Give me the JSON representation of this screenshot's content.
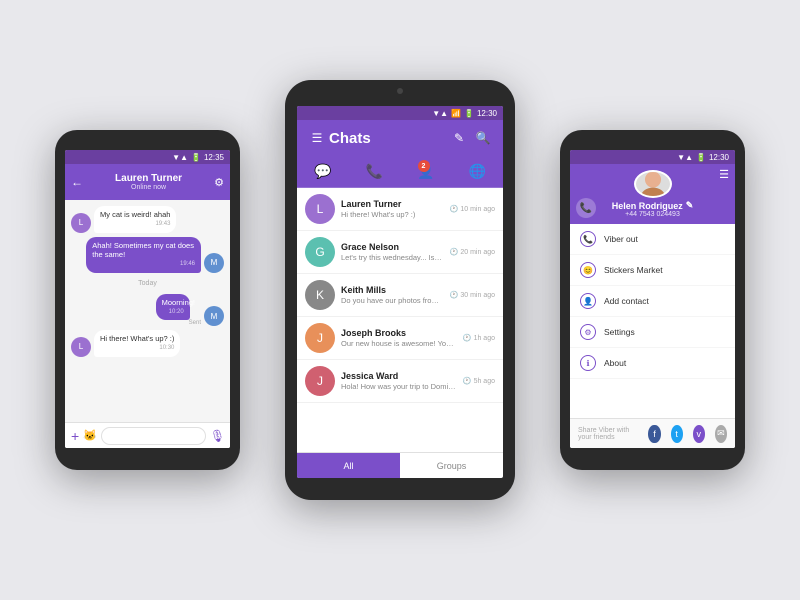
{
  "colors": {
    "purple": "#7b4fc9",
    "purple_dark": "#5a2d90",
    "purple_light": "#9b70d0",
    "bg": "#e8e8ec",
    "phone_shell": "#2a2a2a"
  },
  "center_phone": {
    "status_bar": {
      "time": "12:30"
    },
    "header": {
      "menu_label": "☰",
      "title": "Chats",
      "edit_label": "✎",
      "search_label": "🔍"
    },
    "tabs": [
      {
        "icon": "💬",
        "active": true,
        "label": "Messages"
      },
      {
        "icon": "📞",
        "active": false,
        "label": "Calls"
      },
      {
        "icon": "👤",
        "active": false,
        "label": "Contacts",
        "badge": "2"
      },
      {
        "icon": "🌐",
        "active": false,
        "label": "More"
      }
    ],
    "chats": [
      {
        "name": "Lauren Turner",
        "preview": "Hi there! What's up? :)",
        "time": "10 min ago",
        "avatar_color": "av-purple"
      },
      {
        "name": "Grace Nelson",
        "preview": "Let's try this wednesday... Is that alright? :)",
        "time": "20 min ago",
        "avatar_color": "av-teal"
      },
      {
        "name": "Keith Mills",
        "preview": "Do you have our photos from the nye?",
        "time": "30 min ago",
        "avatar_color": "av-gray"
      },
      {
        "name": "Joseph Brooks",
        "preview": "Our new house is awesome! You should come over to have a look :)",
        "time": "1h ago",
        "avatar_color": "av-orange"
      },
      {
        "name": "Jessica Ward",
        "preview": "Hola! How was your trip to Dominican Republic? OMG So jealous!!",
        "time": "5h ago",
        "avatar_color": "av-pink"
      }
    ],
    "bottom_tabs": [
      {
        "label": "All",
        "active": true
      },
      {
        "label": "Groups",
        "active": false
      }
    ]
  },
  "left_phone": {
    "status_bar": {
      "time": "12:35"
    },
    "contact_name": "Lauren Turner",
    "contact_status": "Online now",
    "messages": [
      {
        "text": "My cat is weird! ahah",
        "time": "19:43",
        "type": "incoming"
      },
      {
        "text": "Ahah! Sometimes my cat does the same!",
        "time": "19:46",
        "type": "outgoing"
      },
      {
        "day_label": "Today"
      },
      {
        "text": "Moorning!",
        "time": "10:20",
        "type": "outgoing",
        "status": "Sent"
      },
      {
        "text": "Hi there! What's up? :)",
        "time": "10:30",
        "type": "incoming"
      }
    ]
  },
  "right_phone": {
    "status_bar": {
      "time": "12:30"
    },
    "profile": {
      "name": "Helen Rodriguez",
      "phone": "+44 7543 024493"
    },
    "menu_items": [
      {
        "icon": "📞",
        "label": "Viber out"
      },
      {
        "icon": "😊",
        "label": "Stickers Market"
      },
      {
        "icon": "👤",
        "label": "Add contact"
      },
      {
        "icon": "⚙",
        "label": "Settings"
      },
      {
        "icon": "ℹ",
        "label": "About"
      }
    ],
    "share": {
      "label": "Share Viber with your friends",
      "icons": [
        {
          "name": "facebook",
          "color": "#3b5998",
          "symbol": "f"
        },
        {
          "name": "twitter",
          "color": "#1da1f2",
          "symbol": "t"
        },
        {
          "name": "viber",
          "color": "#7b4fc9",
          "symbol": "v"
        },
        {
          "name": "email",
          "color": "#aaa",
          "symbol": "✉"
        }
      ]
    }
  }
}
